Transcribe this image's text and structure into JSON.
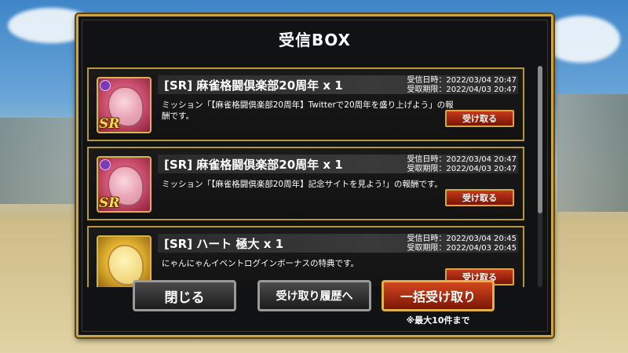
{
  "dialog": {
    "title": "受信BOX"
  },
  "items": [
    {
      "title": "[SR] 麻雀格闘倶楽部20周年 x 1",
      "received": "受信日時：2022/03/04 20:47",
      "deadline": "受取期限：2022/04/03 20:47",
      "description": "ミッション「【麻雀格闘倶楽部20周年】Twitterで20周年を盛り上げよう」の報酬です。",
      "button_label": "受け取る",
      "icon": "dragon-card-icon",
      "badge": "SR"
    },
    {
      "title": "[SR] 麻雀格闘倶楽部20周年 x 1",
      "received": "受信日時：2022/03/04 20:47",
      "deadline": "受取期限：2022/04/03 20:47",
      "description": "ミッション「【麻雀格闘倶楽部20周年】記念サイトを見よう!」の報酬です。",
      "button_label": "受け取る",
      "icon": "dragon-card-icon",
      "badge": "SR"
    },
    {
      "title": "[SR] ハート 極大 x 1",
      "received": "受信日時：2022/03/04 20:45",
      "deadline": "受取期限：2022/04/03 20:45",
      "description": "にゃんにゃんイベントログインボーナスの特典です。",
      "button_label": "受け取る",
      "icon": "gold-heart-icon",
      "badge": ""
    }
  ],
  "buttons": {
    "close": "閉じる",
    "history": "受け取り履歴へ",
    "bulk_receive": "一括受け取り",
    "bulk_note": "※最大10件まで"
  },
  "colors": {
    "frame_gold": "#c9a44a",
    "receive_red": "#c43a1a",
    "panel_bg": "#101214"
  }
}
